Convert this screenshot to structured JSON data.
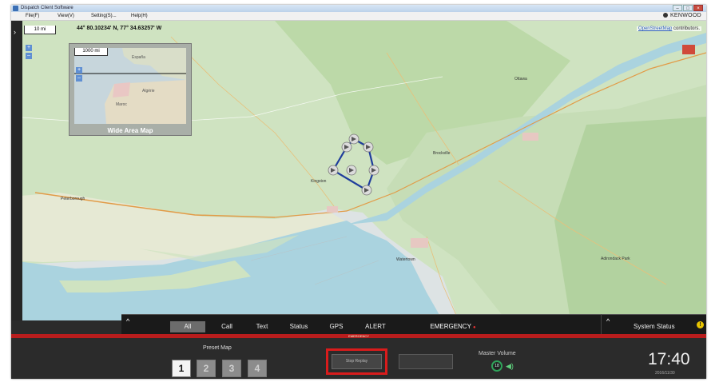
{
  "window": {
    "title": "Dispatch Client Software",
    "controls": [
      "–",
      "□",
      "×"
    ]
  },
  "menu": {
    "items": [
      "File(F)",
      "View(V)",
      "Setting(S)...",
      "Help(H)"
    ],
    "brand": "KENWOOD"
  },
  "map": {
    "scale": "10 mi",
    "coordinates": "44° 80.10234' N, 77° 34.63257' W",
    "attribution_link": "OpenStreetMap",
    "attribution_rest": " contributors.",
    "zoom_in": "+",
    "zoom_out": "–",
    "expand_icon": "›"
  },
  "wide_area_map": {
    "title": "Wide Area Map",
    "scale": "1000 mi",
    "zoom_in": "+",
    "zoom_out": "–",
    "labels": [
      "España",
      "Algérie",
      "Maroc"
    ]
  },
  "map_labels": [
    "Kingston",
    "Brockville",
    "Ottawa",
    "Peterborough",
    "Watertown",
    "Adirondack Park"
  ],
  "tabs": {
    "collapse_icon": "^",
    "items": [
      "All",
      "Call",
      "Text",
      "Status",
      "GPS",
      "ALERT"
    ],
    "active": "All",
    "emergency": "EMERGENCY",
    "emergency_badge": "●"
  },
  "system_status": {
    "label": "System Status",
    "collapse_icon": "^",
    "warning": "!"
  },
  "emergency_bar": {
    "text": "EMERGENCY"
  },
  "preset_map": {
    "title": "Preset Map",
    "buttons": [
      "1",
      "2",
      "3",
      "4"
    ],
    "selected": "1"
  },
  "replay": {
    "stop_label": "Stop Replay"
  },
  "master_volume": {
    "label": "Master Volume",
    "level": "18"
  },
  "clock": {
    "time": "17:40",
    "date": "2016/11/30"
  },
  "colors": {
    "emergency_red": "#b81d1d",
    "highlight_red": "#d91c1c",
    "track_blue": "#1f3d9c",
    "accent_green": "#2fa35a"
  }
}
